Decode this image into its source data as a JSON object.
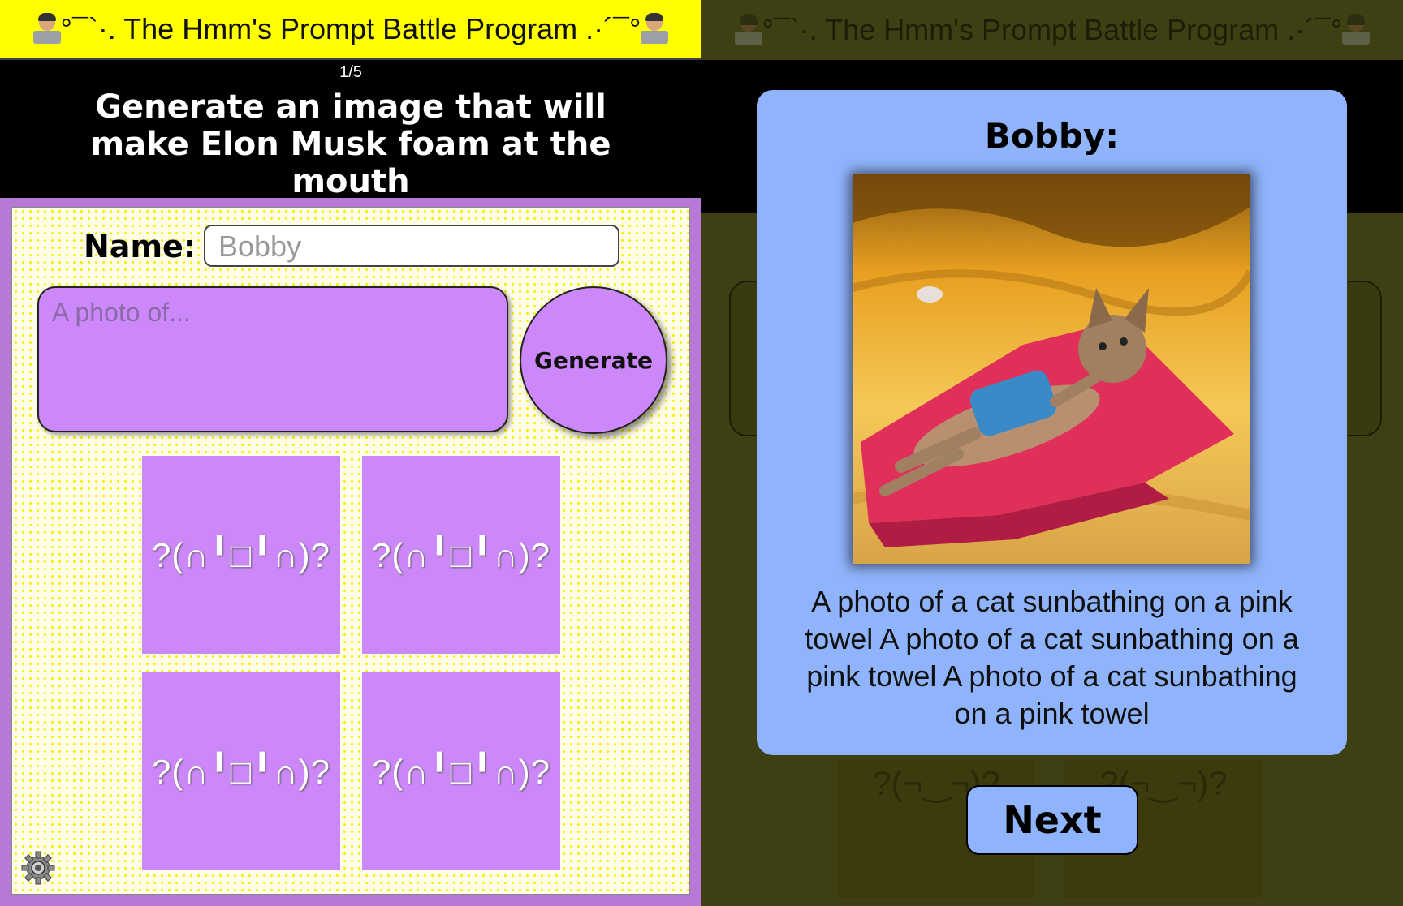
{
  "app": {
    "title": "°¯`·. The Hmm's Prompt Battle Program .·´¯°"
  },
  "round": {
    "counter": "1/5",
    "prompt": "Generate an image that will make Elon Musk foam at the mouth"
  },
  "form": {
    "name_label": "Name:",
    "name_value": "Bobby",
    "prompt_placeholder": "A photo of...",
    "generate_label": "Generate"
  },
  "tiles": [
    "?(∩╹□╹∩)?",
    "?(∩╹□╹∩)?",
    "?(∩╹□╹∩)?",
    "?(∩╹□╹∩)?"
  ],
  "background_tiles": [
    "?(¬‿¬)?",
    "?(¬‿¬)?"
  ],
  "modal": {
    "title": "Bobby:",
    "image_description": "cat sunbathing on a pink towel on sand",
    "caption": "A photo of a cat sunbathing on a pink towel A photo of a cat sunbathing on a pink towel A photo of a cat sunbathing on a pink towel",
    "next_label": "Next"
  },
  "icons": {
    "settings": "gear-icon",
    "user_left": "technologist-icon",
    "user_right": "technologist-icon"
  },
  "colors": {
    "header_yellow": "#ffff00",
    "purple": "#cc88f8",
    "modal_blue": "#8fb4fb",
    "dots_yellow": "#f4f000"
  }
}
